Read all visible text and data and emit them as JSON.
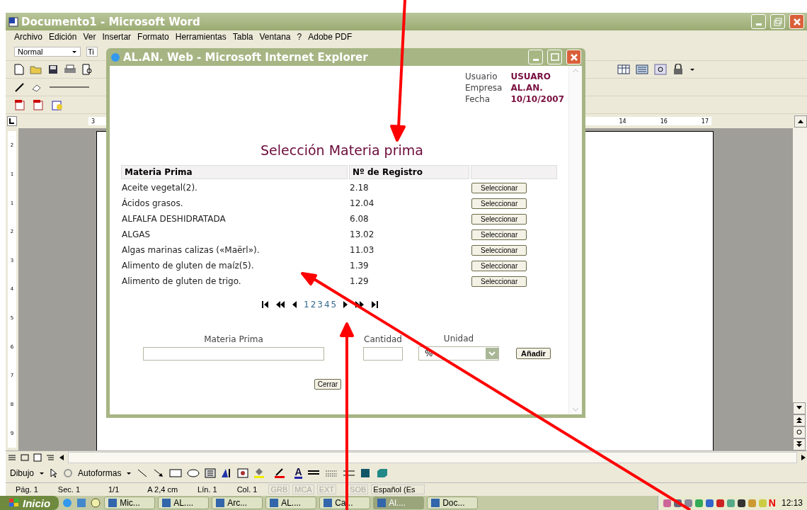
{
  "word": {
    "title": "Documento1 - Microsoft Word",
    "menu": [
      "Archivo",
      "Edición",
      "Ver",
      "Insertar",
      "Formato",
      "Herramientas",
      "Tabla",
      "Ventana",
      "?",
      "Adobe PDF"
    ],
    "style_box": "Normal",
    "font_box": "Ti",
    "ruler_labels": [
      "3",
      "14",
      "16",
      "17"
    ],
    "vertical_ruler_labels": [
      "2",
      "1",
      "1",
      "2",
      "3",
      "4",
      "5",
      "6",
      "7",
      "8",
      "9"
    ],
    "drawing_toolbar": {
      "menu": "Dibujo",
      "autoshapes": "Autoformas",
      "font_color_label": "A"
    },
    "status_bar": {
      "fields": [
        "Pág. 1",
        "Sec. 1",
        "1/1",
        "A 2,4 cm",
        "Lín. 1",
        "Col. 1"
      ],
      "indicators": [
        {
          "label": "GRB",
          "disabled": true
        },
        {
          "label": "MCA",
          "disabled": true
        },
        {
          "label": "EXT",
          "disabled": true
        },
        {
          "label": "SOB",
          "disabled": true
        }
      ],
      "language": "Español (Es"
    }
  },
  "popup": {
    "title": "AL.AN. Web - Microsoft Internet Explorer",
    "info": [
      {
        "label": "Usuario",
        "value": "USUARO"
      },
      {
        "label": "Empresa",
        "value": "AL.AN."
      },
      {
        "label": "Fecha",
        "value": "10/10/2007"
      }
    ],
    "heading": "Selección Materia prima",
    "table": {
      "columns": [
        "Materia Prima",
        "Nº de Registro"
      ],
      "rows": [
        {
          "name": "Aceite vegetal(2).",
          "registro": "2.18",
          "action": "Seleccionar"
        },
        {
          "name": "Ácidos grasos.",
          "registro": "12.04",
          "action": "Seleccionar"
        },
        {
          "name": "ALFALFA DESHIDRATADA",
          "registro": "6.08",
          "action": "Seleccionar"
        },
        {
          "name": "ALGAS",
          "registro": "13.02",
          "action": "Seleccionar"
        },
        {
          "name": "Algas marinas calizas («Maërl»).",
          "registro": "11.03",
          "action": "Seleccionar"
        },
        {
          "name": "Alimento de gluten de maíz(5).",
          "registro": "1.39",
          "action": "Seleccionar"
        },
        {
          "name": "Alimento de gluten de trigo.",
          "registro": "1.29",
          "action": "Seleccionar"
        }
      ]
    },
    "pager": [
      "1",
      "2",
      "3",
      "4",
      "5"
    ],
    "form": {
      "material_label": "Materia Prima",
      "quantity_label": "Cantidad",
      "unit_label": "Unidad",
      "unit_value": "%",
      "add_button": "Añadir"
    },
    "close_button": "Cerrar"
  },
  "taskbar": {
    "start": "Inicio",
    "tasks": [
      {
        "label": "Mic...",
        "selected": false
      },
      {
        "label": "AL....",
        "selected": false
      },
      {
        "label": "Arc...",
        "selected": false
      },
      {
        "label": "AL....",
        "selected": false
      },
      {
        "label": "Ca...",
        "selected": false
      },
      {
        "label": "Al....",
        "selected": true
      },
      {
        "label": "Doc...",
        "selected": false
      }
    ],
    "tray_label": "N",
    "clock": "12:13"
  }
}
